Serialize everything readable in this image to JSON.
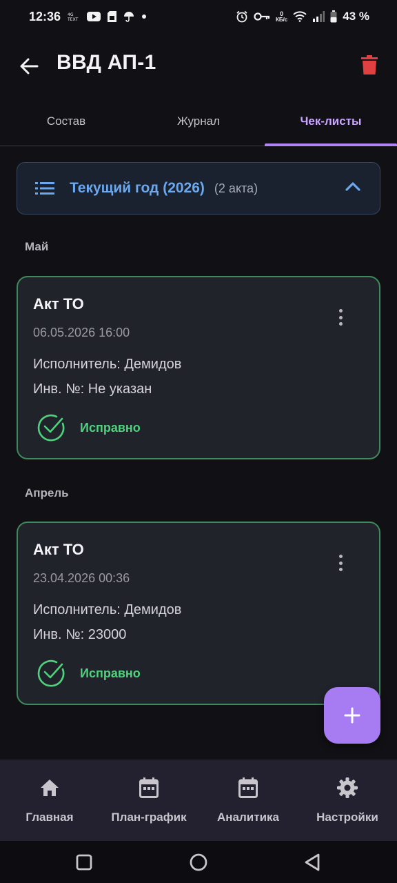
{
  "status_bar": {
    "time": "12:36",
    "icons_left": [
      "network-speed-icon",
      "youtube-icon",
      "sim-icon",
      "umbrella-icon",
      "dot-icon"
    ],
    "icons_right": [
      "alarm-icon",
      "vpn-key-icon",
      "data-speed-icon",
      "wifi-icon",
      "signal-icon",
      "battery-icon"
    ],
    "data_speed_top": "0",
    "data_speed_bottom": "КБ/с",
    "battery": "43 %"
  },
  "app_bar": {
    "title": "ВВД АП-1",
    "back_icon": "arrow-left-icon",
    "delete_icon": "trash-icon",
    "delete_color": "#e04040"
  },
  "tabs": [
    {
      "label": "Состав",
      "active": false
    },
    {
      "label": "Журнал",
      "active": false
    },
    {
      "label": "Чек-листы",
      "active": true
    }
  ],
  "year_group": {
    "title": "Текущий год (2026)",
    "count": "(2 акта)",
    "expanded": true,
    "accent": "#6ba8ee"
  },
  "months": [
    {
      "label": "Май",
      "cards": [
        {
          "title": "Акт ТО",
          "datetime": "06.05.2026 16:00",
          "executor": "Исполнитель: Демидов",
          "inventory": "Инв. №: Не указан",
          "status": "Исправно"
        }
      ]
    },
    {
      "label": "Апрель",
      "cards": [
        {
          "title": "Акт ТО",
          "datetime": "23.04.2026 00:36",
          "executor": "Исполнитель: Демидов",
          "inventory": "Инв. №: 23000",
          "status": "Исправно"
        }
      ]
    }
  ],
  "status_color": "#4fd17d",
  "fab": {
    "icon": "plus-icon",
    "color": "#a77cf2"
  },
  "bottom_nav": [
    {
      "label": "Главная",
      "icon": "home-icon"
    },
    {
      "label": "План-график",
      "icon": "calendar-icon"
    },
    {
      "label": "Аналитика",
      "icon": "calendar-icon"
    },
    {
      "label": "Настройки",
      "icon": "gear-icon"
    }
  ],
  "system_nav": [
    "recents-icon",
    "home-circle-icon",
    "back-triangle-icon"
  ]
}
